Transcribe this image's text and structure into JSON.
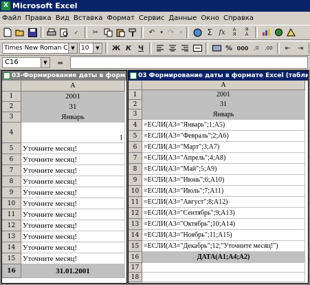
{
  "app": {
    "title": "Microsoft Excel"
  },
  "menu": [
    "Файл",
    "Правка",
    "Вид",
    "Вставка",
    "Формат",
    "Сервис",
    "Данные",
    "Окно",
    "Справка"
  ],
  "format_bar": {
    "font": "Times New Roman Cyr",
    "size": "10",
    "bold": "Ж",
    "italic": "К",
    "underline": "Ч",
    "percent": "%",
    "thousands": "000"
  },
  "formula_bar": {
    "name_box": "C16",
    "fx": "="
  },
  "win1": {
    "title": "03-Формирование даты в форм",
    "col": "A",
    "rows": [
      {
        "n": "1",
        "v": "2001"
      },
      {
        "n": "2",
        "v": "31"
      },
      {
        "n": "3",
        "v": "Январь"
      },
      {
        "n": "4",
        "v": "1"
      },
      {
        "n": "5",
        "v": "Уточните месяц!"
      },
      {
        "n": "6",
        "v": "Уточните месяц!"
      },
      {
        "n": "7",
        "v": "Уточните месяц!"
      },
      {
        "n": "8",
        "v": "Уточните месяц!"
      },
      {
        "n": "9",
        "v": "Уточните месяц!"
      },
      {
        "n": "10",
        "v": "Уточните месяц!"
      },
      {
        "n": "11",
        "v": "Уточните месяц!"
      },
      {
        "n": "12",
        "v": "Уточните месяц!"
      },
      {
        "n": "13",
        "v": "Уточните месяц!"
      },
      {
        "n": "14",
        "v": "Уточните месяц!"
      },
      {
        "n": "15",
        "v": "Уточните месяц!"
      },
      {
        "n": "16",
        "v": "31.01.2001"
      }
    ]
  },
  "win2": {
    "title": "03 Формирование даты в формате Excel (табли",
    "col": "A",
    "rows": [
      {
        "n": "1",
        "v": "2001"
      },
      {
        "n": "2",
        "v": "31"
      },
      {
        "n": "3",
        "v": "Январь"
      },
      {
        "n": "4",
        "v": "=ЕСЛИ(A3=\"Январь\";1;A5)"
      },
      {
        "n": "5",
        "v": "=ЕСЛИ(A3=\"Февраль\";2;A6)"
      },
      {
        "n": "6",
        "v": "=ЕСЛИ(A3=\"Март\";3;A7)"
      },
      {
        "n": "7",
        "v": "=ЕСЛИ(A3=\"Апрель\";4;A8)"
      },
      {
        "n": "8",
        "v": "=ЕСЛИ(A3=\"Май\";5;A9)"
      },
      {
        "n": "9",
        "v": "=ЕСЛИ(A3=\"Июнь\";6;A10)"
      },
      {
        "n": "10",
        "v": "=ЕСЛИ(A3=\"Июль\";7;A11)"
      },
      {
        "n": "11",
        "v": "=ЕСЛИ(A3=\"Август\";8;A12)"
      },
      {
        "n": "12",
        "v": "=ЕСЛИ(A3=\"Сентябрь\";9;A13)"
      },
      {
        "n": "13",
        "v": "=ЕСЛИ(A3=\"Октябрь\";10;A14)"
      },
      {
        "n": "14",
        "v": "=ЕСЛИ(A3=\"Ноябрь\";11;A15)"
      },
      {
        "n": "15",
        "v": "=ЕСЛИ(A3=\"Декабрь\";12;\"Уточните месяц!\")"
      },
      {
        "n": "16",
        "v": "ДАТА(A1;A4;A2)"
      },
      {
        "n": "17",
        "v": ""
      },
      {
        "n": "18",
        "v": ""
      }
    ]
  }
}
